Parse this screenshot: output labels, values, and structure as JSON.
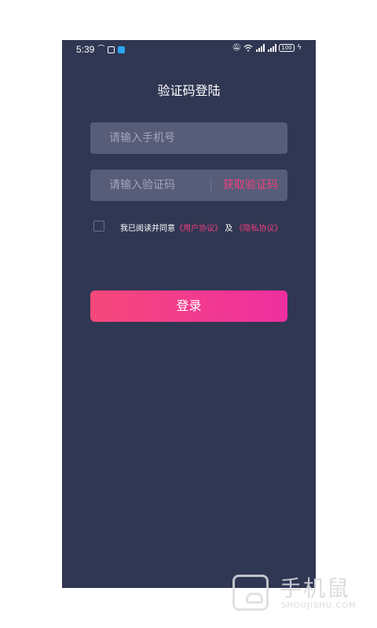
{
  "status_bar": {
    "time": "5:39",
    "battery": "100",
    "icons": [
      "missed-call-icon",
      "sim-icon",
      "app-icon",
      "mute-icon",
      "wifi-icon",
      "signal-icon",
      "signal-icon",
      "charging-icon"
    ]
  },
  "page": {
    "title": "验证码登陆"
  },
  "form": {
    "phone_placeholder": "请输入手机号",
    "code_placeholder": "请输入验证码",
    "get_code_label": "获取验证码"
  },
  "agreement": {
    "prefix": "我已阅读并同意",
    "user_agreement": "《用户协议》",
    "and": "及",
    "privacy_policy": "《隐私协议》"
  },
  "login_button": {
    "label": "登录"
  },
  "watermark": {
    "text": "手机鼠",
    "sub": "SHOUJISHU.COM"
  },
  "colors": {
    "background": "#303753",
    "field": "#575d79",
    "accent": "#f0407c",
    "button_start": "#f5487a",
    "button_end": "#ee2fa0"
  }
}
